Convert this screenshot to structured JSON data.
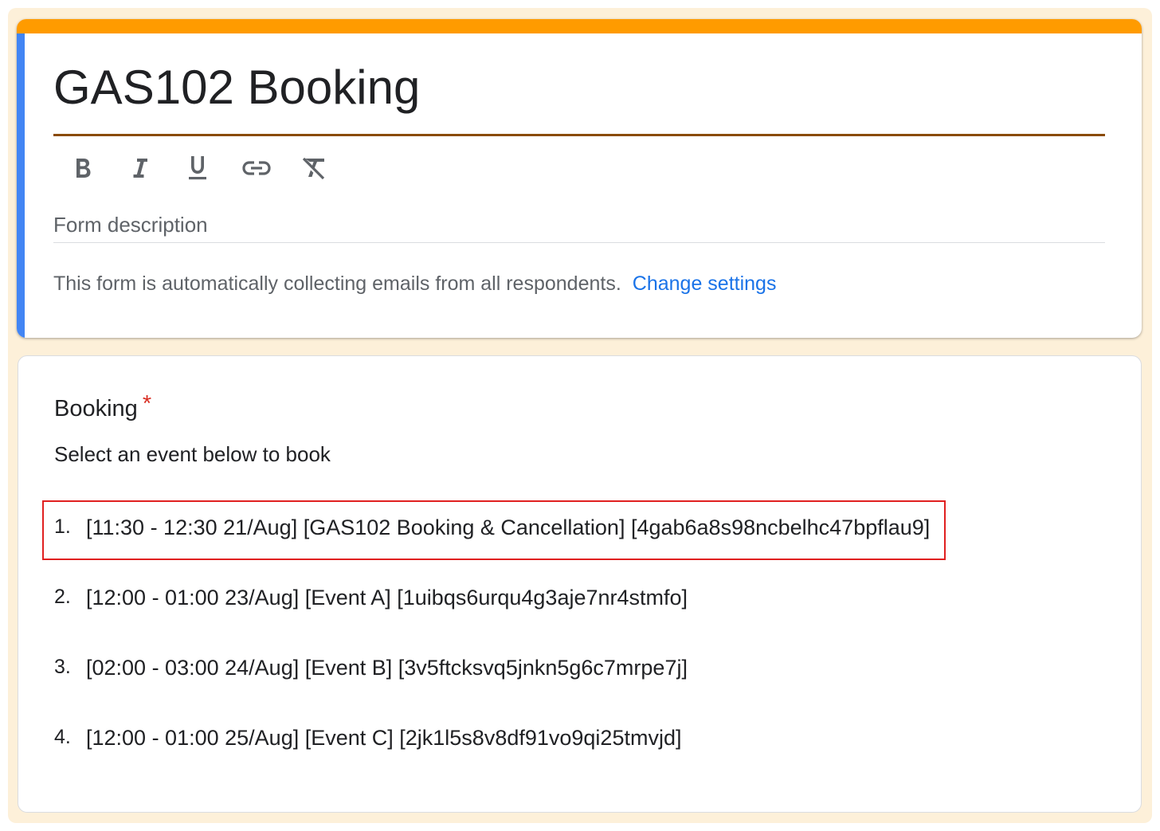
{
  "colors": {
    "page_background": "#fdf0d9",
    "header_top_bar": "#ff9b00",
    "header_left_bar": "#4285f4",
    "title_underline": "#8a4b08",
    "link": "#1a73e8",
    "highlight_border": "#e02020",
    "required_asterisk": "#d93025"
  },
  "header": {
    "title": "GAS102 Booking",
    "toolbar": {
      "bold": "bold-icon",
      "italic": "italic-icon",
      "underline": "underline-icon",
      "link": "link-icon",
      "clear_format": "clear-format-icon"
    },
    "description_placeholder": "Form description",
    "email_notice": "This form is automatically collecting emails from all respondents.",
    "change_settings_label": "Change settings"
  },
  "question": {
    "title": "Booking",
    "required_mark": "*",
    "help_text": "Select an event below to book",
    "events": [
      {
        "number": "1.",
        "text": "[11:30 - 12:30 21/Aug] [GAS102 Booking & Cancellation] [4gab6a8s98ncbelhc47bpflau9]"
      },
      {
        "number": "2.",
        "text": "[12:00 - 01:00 23/Aug] [Event A] [1uibqs6urqu4g3aje7nr4stmfo]"
      },
      {
        "number": "3.",
        "text": "[02:00 - 03:00 24/Aug] [Event B] [3v5ftcksvq5jnkn5g6c7mrpe7j]"
      },
      {
        "number": "4.",
        "text": "[12:00 - 01:00 25/Aug] [Event C] [2jk1l5s8v8df91vo9qi25tmvjd]"
      }
    ]
  }
}
